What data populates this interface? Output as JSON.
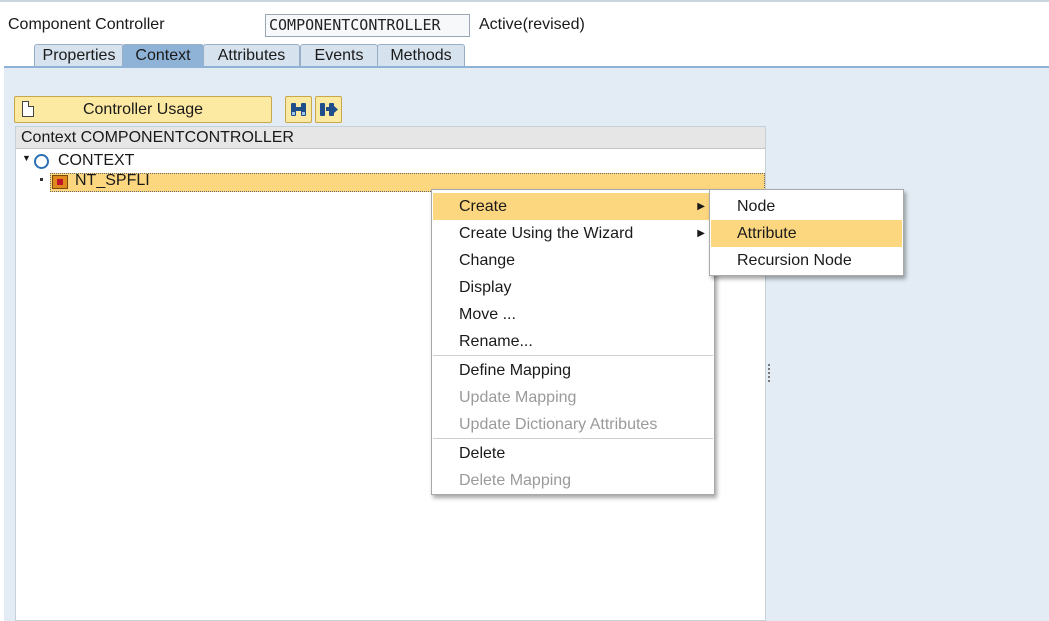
{
  "header": {
    "label": "Component Controller",
    "field_value": "COMPONENTCONTROLLER",
    "status": "Active(revised)"
  },
  "tabs": [
    {
      "label": "Properties",
      "active": false
    },
    {
      "label": "Context",
      "active": true
    },
    {
      "label": "Attributes",
      "active": false
    },
    {
      "label": "Events",
      "active": false
    },
    {
      "label": "Methods",
      "active": false
    }
  ],
  "toolbar": {
    "usage_button": "Controller Usage",
    "icon1": "binoculars-icon",
    "icon2": "find-next-icon"
  },
  "tree": {
    "title": "Context COMPONENTCONTROLLER",
    "root": "CONTEXT",
    "child": "NT_SPFLI"
  },
  "context_menu": {
    "items": [
      {
        "label": "Create",
        "enabled": true,
        "submenu": true,
        "highlighted": true
      },
      {
        "label": "Create Using the Wizard",
        "enabled": true,
        "submenu": true
      },
      {
        "label": "Change",
        "enabled": true
      },
      {
        "label": "Display",
        "enabled": true
      },
      {
        "label": "Move ...",
        "enabled": true
      },
      {
        "label": "Rename...",
        "enabled": true
      },
      {
        "label": "Define Mapping",
        "enabled": true
      },
      {
        "label": "Update Mapping",
        "enabled": false
      },
      {
        "label": "Update Dictionary Attributes",
        "enabled": false
      },
      {
        "label": "Delete",
        "enabled": true
      },
      {
        "label": "Delete Mapping",
        "enabled": false
      }
    ]
  },
  "submenu": {
    "items": [
      {
        "label": "Node",
        "highlighted": false
      },
      {
        "label": "Attribute",
        "highlighted": true
      },
      {
        "label": "Recursion Node",
        "highlighted": false
      }
    ]
  },
  "colors": {
    "highlight": "#fcd77f",
    "button": "#fdeaa2",
    "tab_active": "#8fb3d6",
    "panel": "#e3ecf5"
  }
}
